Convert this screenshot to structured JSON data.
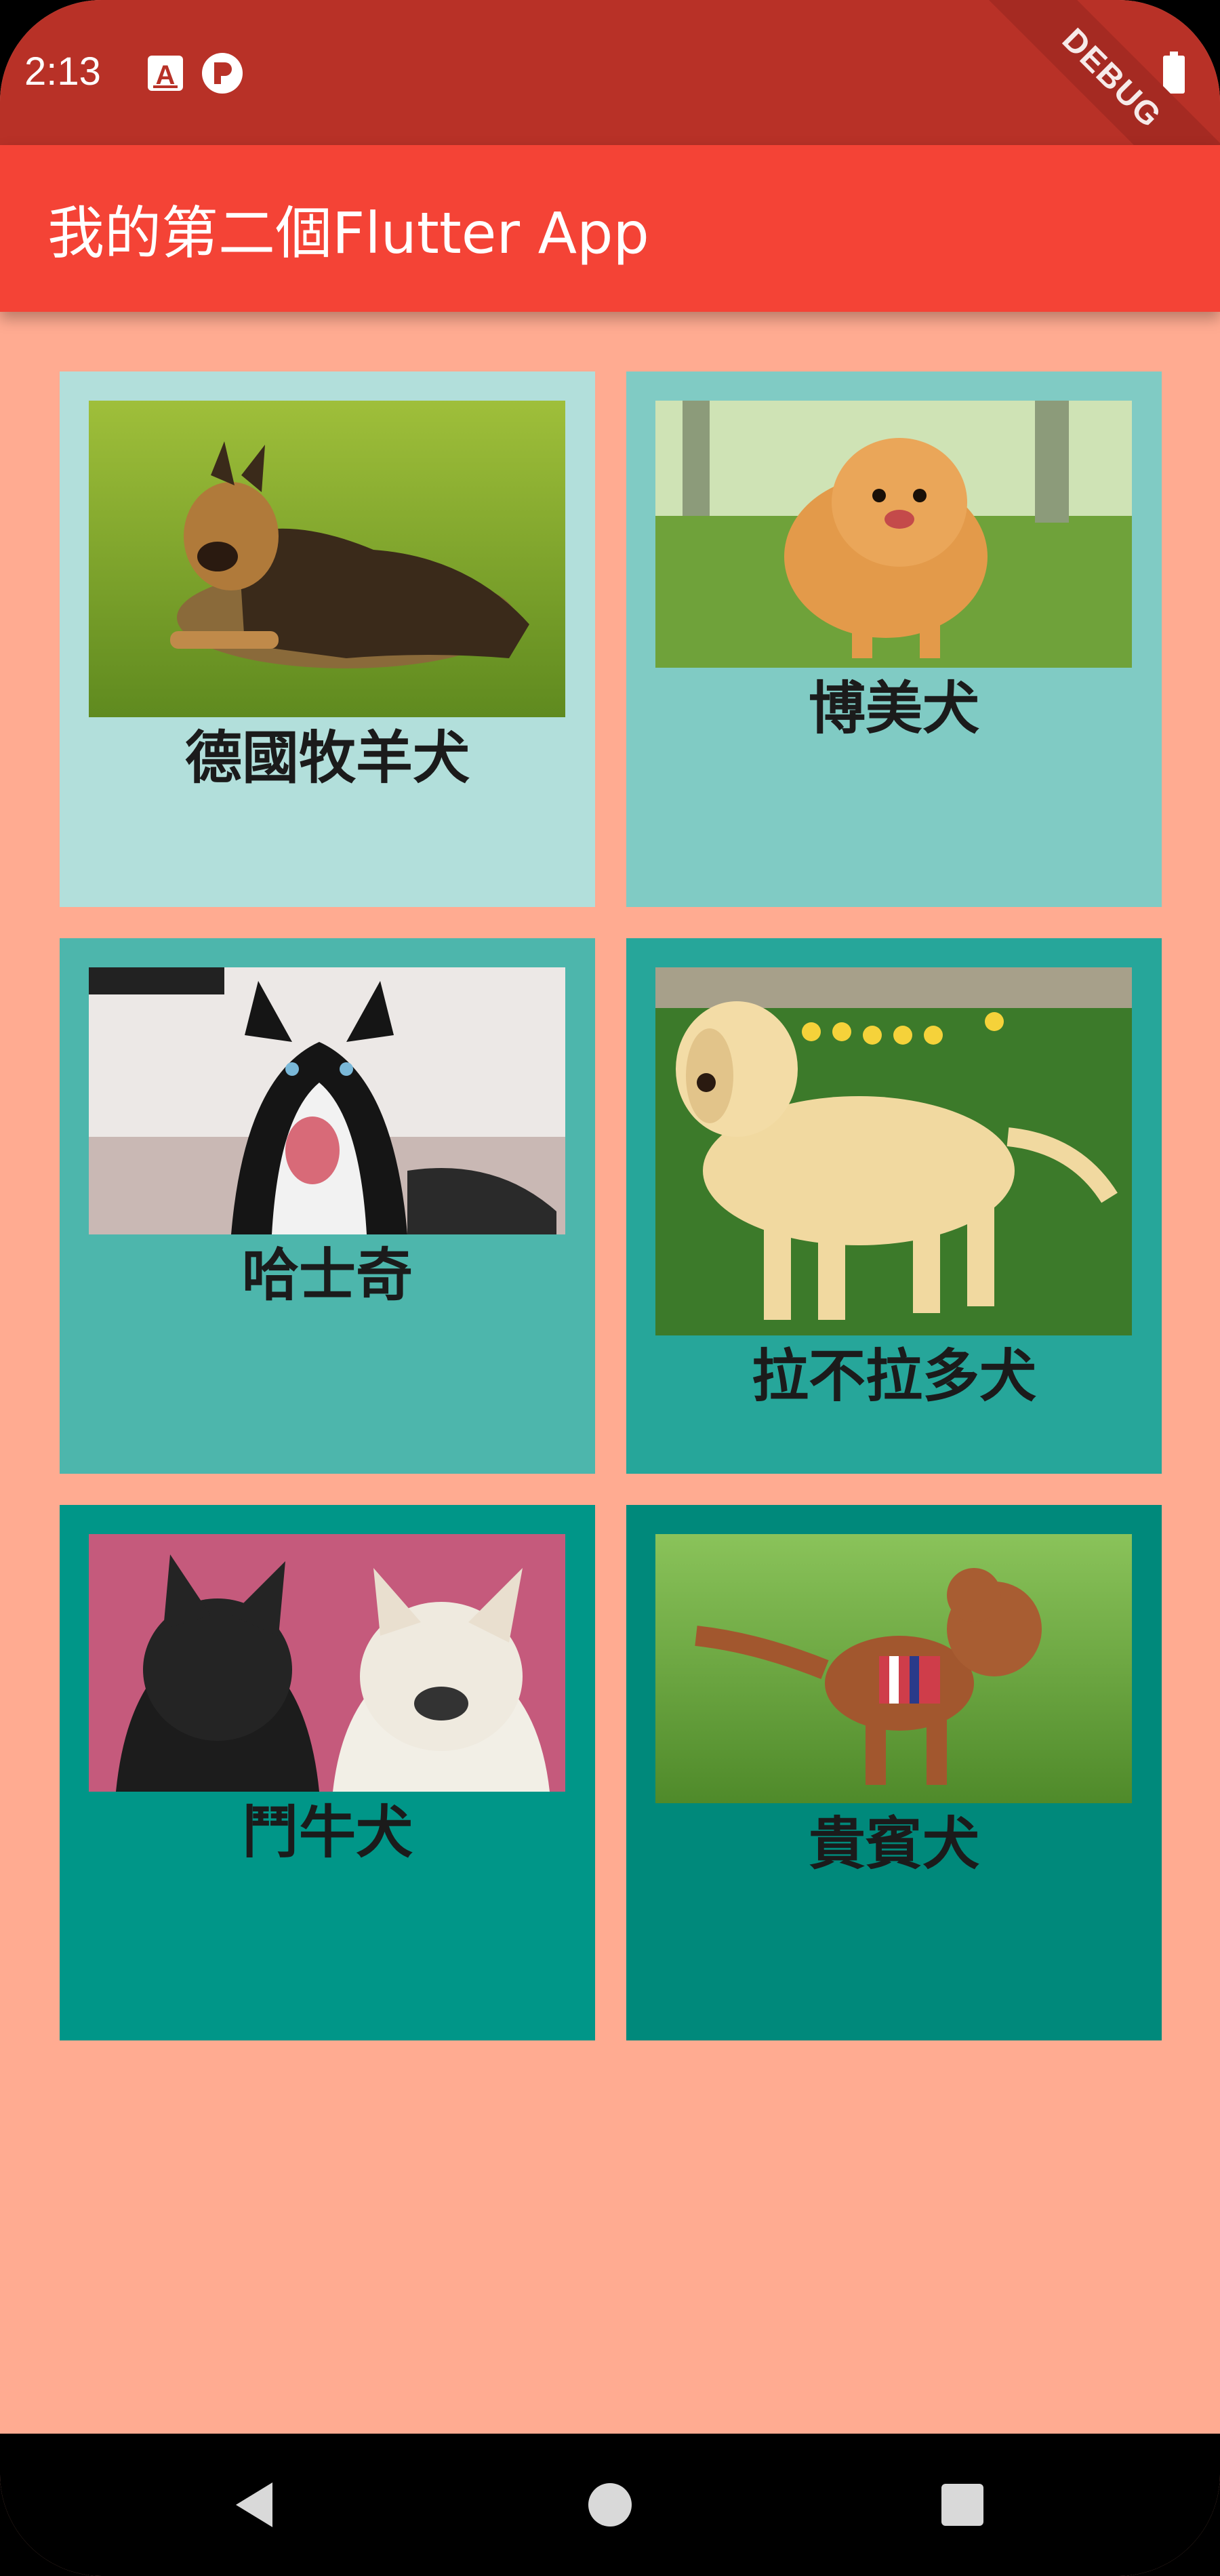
{
  "status_bar": {
    "time": "2:13",
    "debug_banner": "DEBUG",
    "icons": [
      "a-notification-icon",
      "p-notification-icon",
      "wifi-icon",
      "battery-icon"
    ]
  },
  "app_bar": {
    "title": "我的第二個Flutter App"
  },
  "colors": {
    "background": "#FFAB91",
    "status_bar": "#B83127",
    "app_bar": "#F44336",
    "card_1": "#B2DFDB",
    "card_2": "#80CBC4",
    "card_3": "#4DB6AC",
    "card_4": "#26A69A",
    "card_5": "#009688",
    "card_6": "#00897B"
  },
  "cards": [
    {
      "label": "德國牧羊犬",
      "image": "german-shepherd-photo"
    },
    {
      "label": "博美犬",
      "image": "pomeranian-photo"
    },
    {
      "label": "哈士奇",
      "image": "husky-photo"
    },
    {
      "label": "拉不拉多犬",
      "image": "labrador-photo"
    },
    {
      "label": "鬥牛犬",
      "image": "french-bulldog-photo"
    },
    {
      "label": "貴賓犬",
      "image": "poodle-photo"
    }
  ],
  "nav_bar": {
    "buttons": [
      "back-icon",
      "home-icon",
      "recents-icon"
    ]
  }
}
